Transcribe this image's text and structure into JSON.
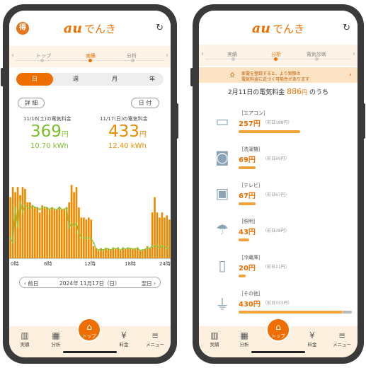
{
  "left": {
    "badge": "得",
    "logo_au": "au",
    "logo_denki": "でんき",
    "refresh_icon": "refresh-icon",
    "tabs": [
      "トップ",
      "実績",
      "分析"
    ],
    "segments": [
      "日",
      "週",
      "月",
      "年"
    ],
    "detail_label": "詳 細",
    "date_label": "日 付",
    "day1": {
      "caption": "11/16(土)の電気料金",
      "value": "369",
      "unit": "円",
      "kwh": "10.70 kWh",
      "color": "#7bbf2a"
    },
    "day2": {
      "caption": "11/17(日)の電気料金",
      "value": "433",
      "unit": "円",
      "kwh": "12.40 kWh",
      "color": "#ee8a00"
    },
    "chart_ticks": [
      "0時",
      "6時",
      "12時",
      "18時",
      "24時"
    ],
    "date_nav": {
      "prev": "前日",
      "current": "2024年 11月17日（日）",
      "next": "翌日"
    },
    "nav": [
      "実績",
      "分析",
      "トップ",
      "料金",
      "メニュー"
    ]
  },
  "right": {
    "logo_au": "au",
    "logo_denki": "でんき",
    "tabs": [
      "実績",
      "分析",
      "電気診断"
    ],
    "notice_line1": "家電を登録すると、より実際の",
    "notice_line2": "電気料金に近づく可能性があります",
    "title_pre": "2月11日の電気料金",
    "title_amt": "886",
    "title_unit": "円",
    "title_post": "のうち",
    "appliances": [
      {
        "cat": "［エアコン］",
        "val": "257円",
        "prev": "（前日188円）",
        "icon": "air-conditioner-icon",
        "ratio": 0.29
      },
      {
        "cat": "［洗濯機］",
        "val": "69円",
        "prev": "（前日69円）",
        "icon": "washing-machine-icon",
        "ratio": 0.08
      },
      {
        "cat": "［テレビ］",
        "val": "67円",
        "prev": "（前日67円）",
        "icon": "tv-icon",
        "ratio": 0.08
      },
      {
        "cat": "［照明］",
        "val": "43円",
        "prev": "（前日38円）",
        "icon": "light-icon",
        "ratio": 0.05
      },
      {
        "cat": "［冷蔵庫］",
        "val": "20円",
        "prev": "（前日21円）",
        "icon": "fridge-icon",
        "ratio": 0.03
      },
      {
        "cat": "［その他］",
        "val": "430円",
        "prev": "（前日333円）",
        "icon": "plug-icon",
        "ratio": 0.49
      }
    ],
    "nav": [
      "実績",
      "分析",
      "トップ",
      "料金",
      "メニュー"
    ]
  },
  "chart_data": {
    "type": "bar",
    "x_ticks": [
      "0時",
      "6時",
      "12時",
      "18時",
      "24時"
    ],
    "series": [
      {
        "values": [
          0.6,
          0.7,
          0.65,
          0.7,
          0.62,
          0.7,
          0.68,
          0.55,
          0.55,
          0.52,
          0.5,
          0.5,
          0.45,
          0.52,
          0.5,
          0.5,
          0.48,
          0.5,
          0.48,
          0.48,
          0.5,
          0.48,
          0.48,
          0.5,
          0.55,
          0.72,
          0.65,
          0.7,
          0.5,
          0.4,
          0.4,
          0.38,
          0.4,
          0.38,
          0.12,
          0.1,
          0.08,
          0.1,
          0.09,
          0.1,
          0.1,
          0.09,
          0.1,
          0.1,
          0.09,
          0.08,
          0.1,
          0.09,
          0.1,
          0.1,
          0.09,
          0.1,
          0.1,
          0.08,
          0.08,
          0.09,
          0.12,
          0.1,
          0.45,
          0.6,
          0.45,
          0.4,
          0.45,
          0.4,
          0.42,
          0.38
        ]
      },
      {
        "values": [
          0.2,
          0.15,
          0.5,
          0.3,
          0.55,
          0.45,
          0.52,
          0.5,
          0.49,
          0.52,
          0.5,
          0.5,
          0.48,
          0.5,
          0.5,
          0.5,
          0.48,
          0.5,
          0.48,
          0.48,
          0.5,
          0.48,
          0.48,
          0.5,
          0.3,
          0.35,
          0.32,
          0.35,
          0.25,
          0.2,
          0.2,
          0.2,
          0.2,
          0.2,
          0.15,
          0.1,
          0.08,
          0.09,
          0.08,
          0.1,
          0.09,
          0.08,
          0.1,
          0.09,
          0.1,
          0.08,
          0.1,
          0.09,
          0.1,
          0.1,
          0.09,
          0.09,
          0.1,
          0.08,
          0.08,
          0.09,
          0.1,
          0.1,
          0.12,
          0.12,
          0.12,
          0.1,
          0.12,
          0.12,
          0.1,
          0.1
        ]
      }
    ],
    "colors": [
      "#ee8a00",
      "#8cc63f"
    ]
  }
}
